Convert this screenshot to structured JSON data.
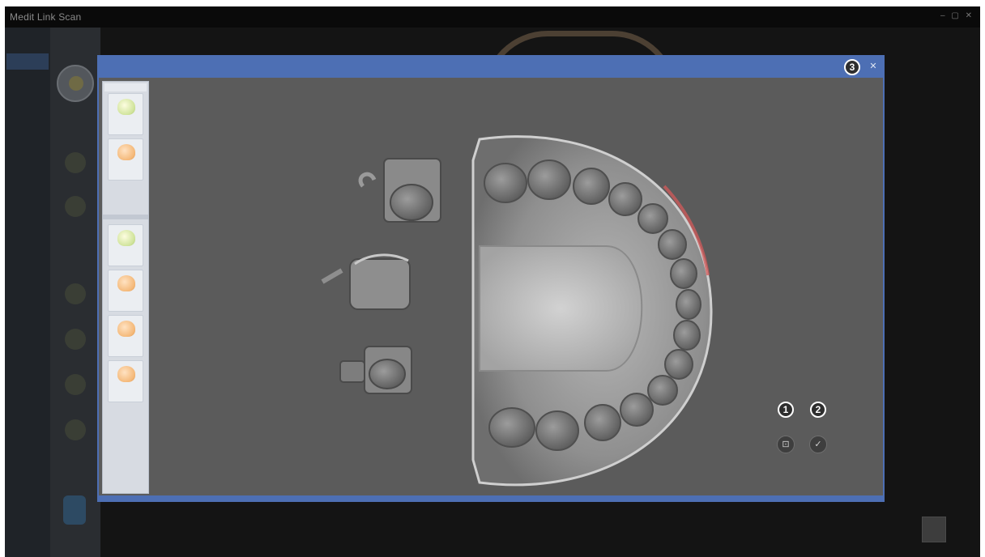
{
  "app": {
    "title": "Medit Link Scan",
    "window_controls": [
      "–",
      "▢",
      "✕"
    ]
  },
  "left_nav": {
    "tiny_label": "",
    "items": [
      "",
      "",
      ""
    ]
  },
  "dialog": {
    "title": "",
    "close_glyph": "✕",
    "callouts": {
      "one": "1",
      "two": "2",
      "three": "3"
    },
    "buttons": [
      {
        "label": "",
        "icon": "fit-view-icon",
        "glyph": "⊡"
      },
      {
        "label": "",
        "icon": "confirm-check-icon",
        "glyph": "✓"
      }
    ]
  },
  "list_panel": {
    "items": [
      {
        "tooth_color": "green",
        "label": ""
      },
      {
        "tooth_color": "orange",
        "label": ""
      },
      {
        "tooth_color": "green",
        "label": ""
      },
      {
        "tooth_color": "orange",
        "label": ""
      },
      {
        "tooth_color": "orange",
        "label": ""
      },
      {
        "tooth_color": "orange",
        "label": ""
      }
    ]
  },
  "colors": {
    "accent": "#4d6fb4",
    "background": "#141414",
    "viewport": "#5b5b5b",
    "model": "#9a9a9a",
    "margin_highlight": "#d35a5a"
  }
}
